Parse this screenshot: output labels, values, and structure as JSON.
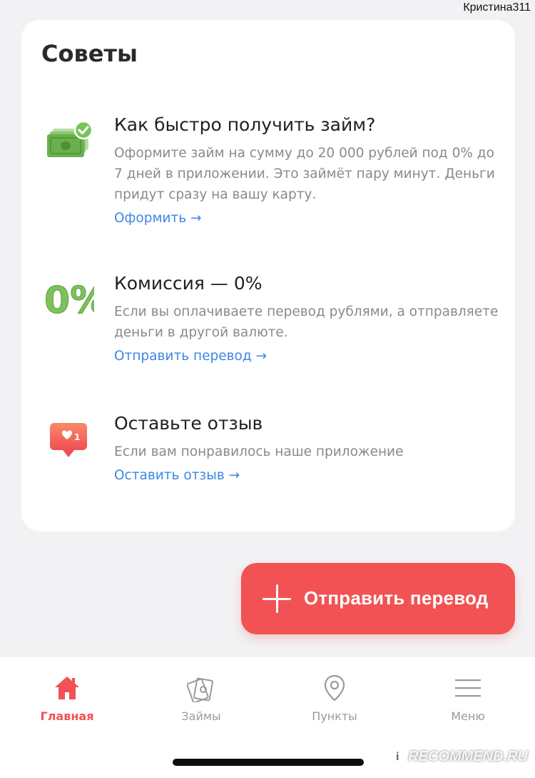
{
  "watermark_user": "Кристина311",
  "card": {
    "title": "Советы",
    "tips": [
      {
        "icon": "money-check-icon",
        "heading": "Как быстро получить займ?",
        "text": "Оформите займ на сумму до 20 000 рублей под 0% до 7 дней в приложении. Это займёт пару минут. Деньги придут сразу на вашу карту.",
        "link": "Оформить →"
      },
      {
        "icon": "zero-percent-icon",
        "heading": "Комиссия — 0%",
        "text": "Если вы оплачиваете перевод рублями, а отправляете деньги в другой валюте.",
        "link": "Отправить перевод →"
      },
      {
        "icon": "like-notification-icon",
        "heading": "Оставьте отзыв",
        "text": "Если вам понравилось наше приложение",
        "link": "Оставить отзыв →"
      }
    ]
  },
  "icons": {
    "zero_percent_text": "0%",
    "like_count": "1"
  },
  "fab": {
    "label": "Отправить перевод",
    "icon": "plus-icon"
  },
  "tabbar": {
    "tabs": [
      {
        "label": "Главная",
        "icon": "home-icon",
        "active": true
      },
      {
        "label": "Займы",
        "icon": "money-icon",
        "active": false
      },
      {
        "label": "Пункты",
        "icon": "location-pin-icon",
        "active": false
      },
      {
        "label": "Меню",
        "icon": "menu-icon",
        "active": false
      }
    ]
  },
  "colors": {
    "accent": "#f25253",
    "link": "#3b87e6",
    "icon_green": "#6ab04c",
    "tab_inactive": "#9a9a9a"
  },
  "watermark": {
    "badge": "i",
    "text": "RECOMMEND.RU"
  }
}
